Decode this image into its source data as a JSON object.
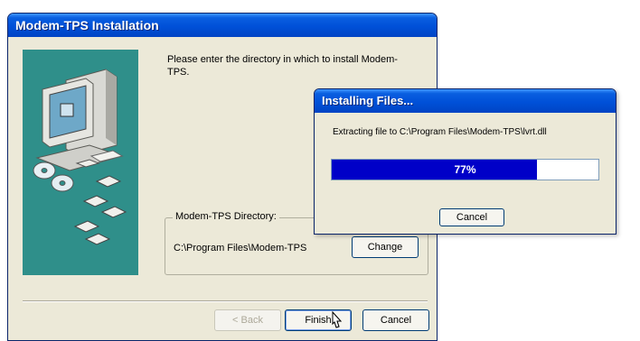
{
  "main_window": {
    "title": "Modem-TPS Installation",
    "prompt": "Please enter the directory in which to install Modem-TPS.",
    "directory_group_label": "Modem-TPS Directory:",
    "directory_path": "C:\\Program Files\\Modem-TPS",
    "change_label": "Change",
    "back_label": "< Back",
    "finish_label": "Finish",
    "cancel_label": "Cancel"
  },
  "install_dialog": {
    "title": "Installing Files...",
    "extract_text": "Extracting file to C:\\Program Files\\Modem-TPS\\lvrt.dll",
    "progress_percent": 77,
    "progress_label": "77%",
    "cancel_label": "Cancel"
  },
  "colors": {
    "title_bar": "#0050d8",
    "art_panel": "#2f8f8a",
    "progress_fill": "#0000c8",
    "dialog_face": "#ece9d8"
  },
  "icons": [
    "computer-icon",
    "cd-discs-icon",
    "floppy-disks-icon",
    "mouse-cursor-icon"
  ]
}
